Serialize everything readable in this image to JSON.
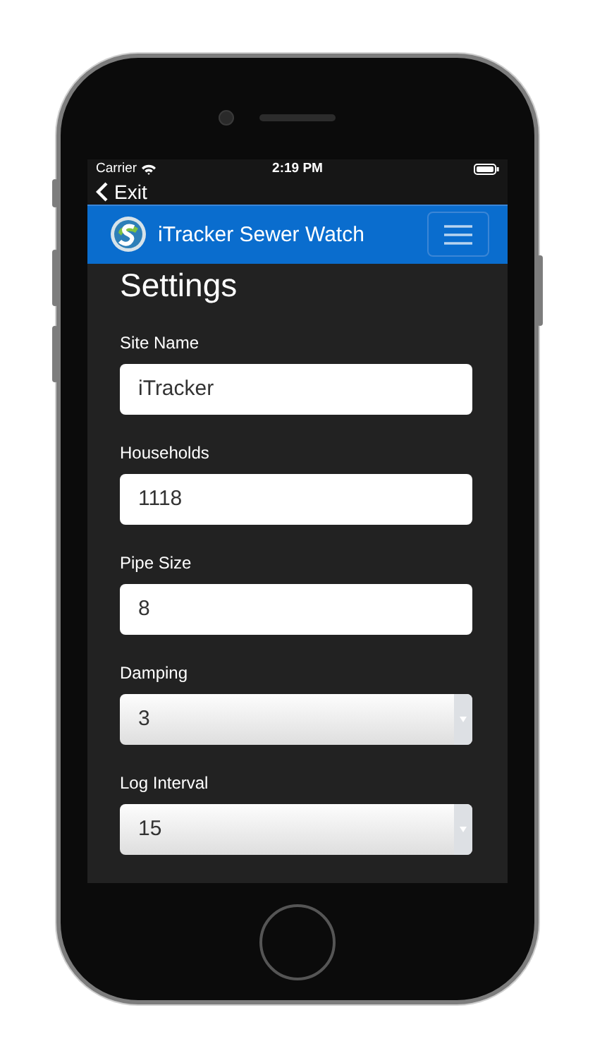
{
  "status_bar": {
    "carrier": "Carrier",
    "time": "2:19 PM"
  },
  "nav": {
    "back_label": "Exit"
  },
  "header": {
    "title": "iTracker Sewer Watch"
  },
  "page_title": "Settings",
  "fields": [
    {
      "label": "Site Name",
      "kind": "text",
      "value": "iTracker"
    },
    {
      "label": "Households",
      "kind": "text",
      "value": "1118"
    },
    {
      "label": "Pipe Size",
      "kind": "text",
      "value": "8"
    },
    {
      "label": "Damping",
      "kind": "select",
      "value": "3"
    },
    {
      "label": "Log Interval",
      "kind": "select",
      "value": "15"
    }
  ]
}
